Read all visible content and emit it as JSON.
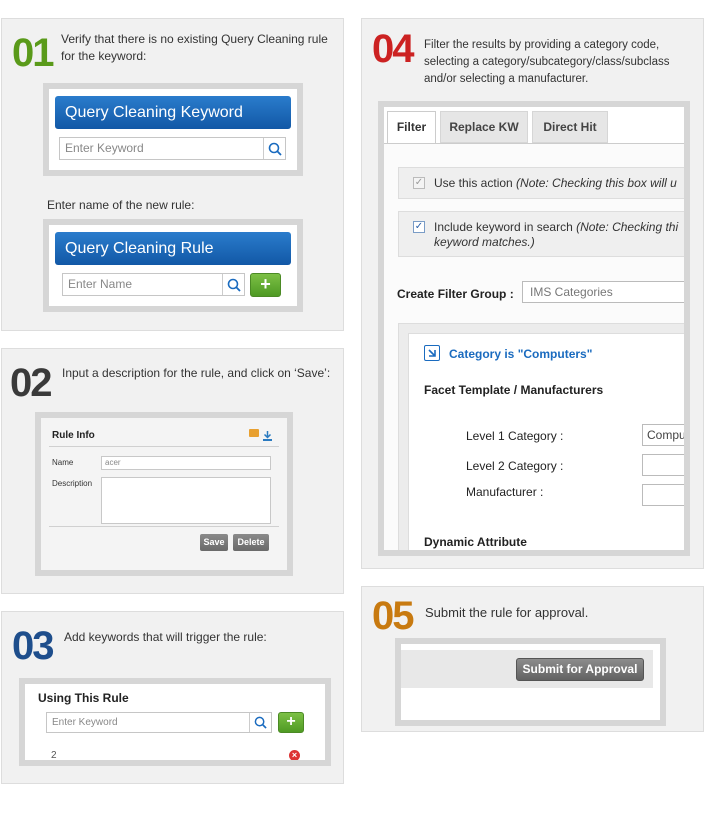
{
  "step1": {
    "number": "01",
    "number_color": "#5a9a1a",
    "text": "Verify that there is no existing Query Cleaning rule for the keyword:",
    "keyword_header": "Query Cleaning Keyword",
    "keyword_placeholder": "Enter Keyword",
    "rule_prompt": "Enter name of the new rule:",
    "rule_header": "Query Cleaning Rule",
    "rule_placeholder": "Enter Name",
    "add_label": "+"
  },
  "step2": {
    "number": "02",
    "number_color": "#3a3a3a",
    "text": "Input a description for the rule, and click on ‘Save’:",
    "panel_title": "Rule Info",
    "name_label": "Name",
    "name_value": "acer",
    "description_label": "Description",
    "save_label": "Save",
    "delete_label": "Delete"
  },
  "step3": {
    "number": "03",
    "number_color": "#1e4e8c",
    "text": "Add keywords that will trigger the rule:",
    "panel_title": "Using This Rule",
    "keyword_placeholder": "Enter Keyword",
    "add_label": "+",
    "row_value": "2"
  },
  "step4": {
    "number": "04",
    "number_color": "#cc2222",
    "text": "Filter the results by providing a category code, selecting a category/subcategory/class/subclass and/or selecting a manufacturer.",
    "tabs": [
      "Filter",
      "Replace KW",
      "Direct Hit"
    ],
    "use_action_text": "Use this action ",
    "use_action_note": "(Note: Checking this box will u",
    "include_kw_text": "Include keyword in search ",
    "include_kw_note": "(Note: Checking thi",
    "include_kw_note2": "keyword matches.)",
    "filter_group_label": "Create Filter Group :",
    "filter_group_value": "IMS Categories",
    "category_title": "Category is \"Computers\"",
    "facet_title": "Facet Template / Manufacturers",
    "level1_label": "Level 1 Category :",
    "level1_value": "Compu",
    "level2_label": "Level 2 Category :",
    "manufacturer_label": "Manufacturer :",
    "dynamic_title": "Dynamic Attribute"
  },
  "step5": {
    "number": "05",
    "number_color": "#c87a10",
    "text": "Submit the rule for approval.",
    "submit_label": "Submit for Approval"
  }
}
